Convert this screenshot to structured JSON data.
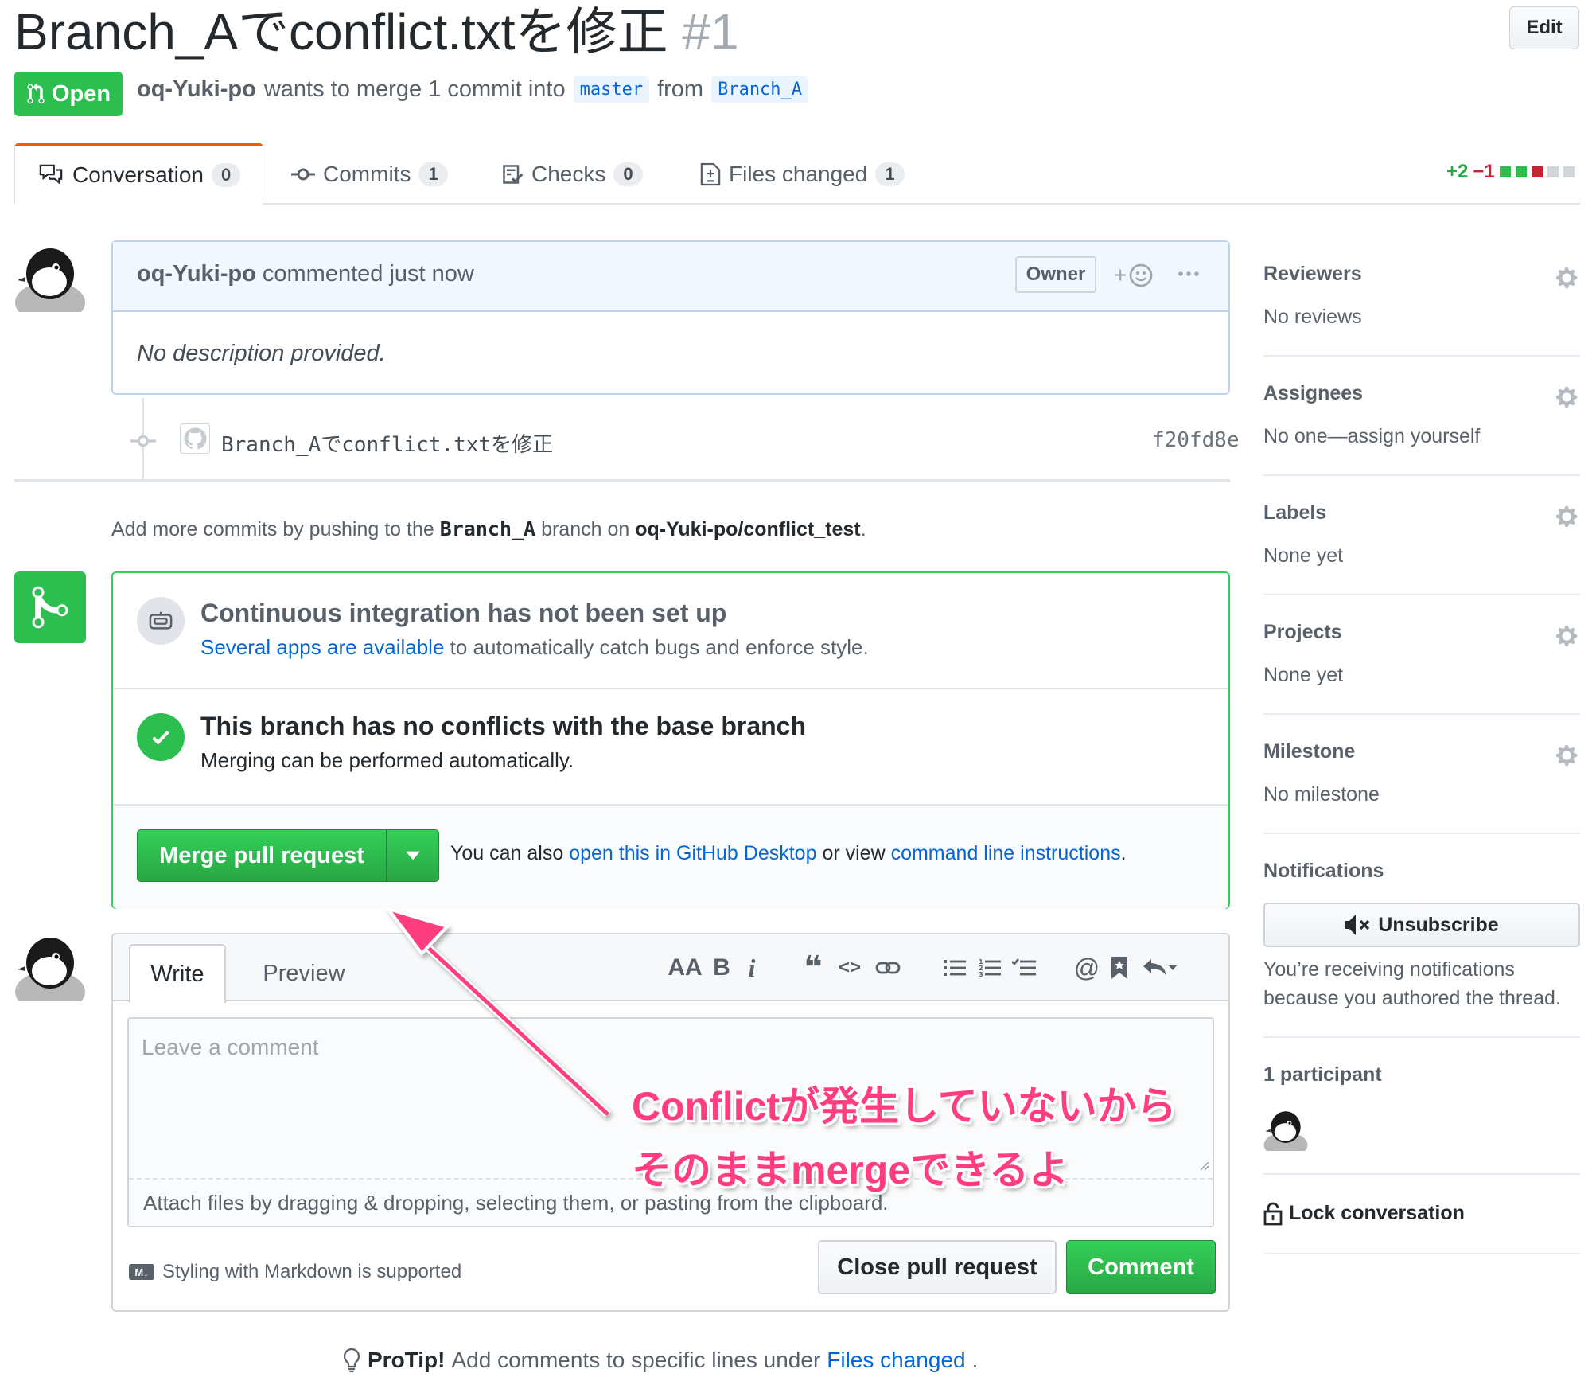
{
  "header": {
    "title": "Branch_Aでconflict.txtを修正",
    "number": "#1",
    "edit_label": "Edit",
    "state_label": "Open",
    "author": "oq-Yuki-po",
    "merge_text": "wants to merge 1 commit into",
    "base_branch": "master",
    "from_text": "from",
    "head_branch": "Branch_A"
  },
  "tabs": [
    {
      "label": "Conversation",
      "count": "0"
    },
    {
      "label": "Commits",
      "count": "1"
    },
    {
      "label": "Checks",
      "count": "0"
    },
    {
      "label": "Files changed",
      "count": "1"
    }
  ],
  "diffstat": {
    "additions": "+2",
    "deletions": "−1"
  },
  "comment": {
    "author": "oq-Yuki-po",
    "action": "commented just now",
    "role_badge": "Owner",
    "add_reaction": "+",
    "body": "No description provided."
  },
  "commit": {
    "message": "Branch_Aでconflict.txtを修正",
    "sha": "f20fd8e"
  },
  "push_note": {
    "prefix": "Add more commits by pushing to the",
    "branch": "Branch_A",
    "middle": "branch on",
    "repo": "oq-Yuki-po/conflict_test",
    "suffix": "."
  },
  "merge_box": {
    "ci_title": "Continuous integration has not been set up",
    "ci_link": "Several apps are available",
    "ci_rest": "to automatically catch bugs and enforce style.",
    "conflict_title": "This branch has no conflicts with the base branch",
    "conflict_sub": "Merging can be performed automatically.",
    "merge_button": "Merge pull request",
    "note_prefix": "You can also",
    "note_link1": "open this in GitHub Desktop",
    "note_mid": "or view",
    "note_link2": "command line instructions",
    "note_suffix": "."
  },
  "new_comment": {
    "tab_write": "Write",
    "tab_preview": "Preview",
    "placeholder": "Leave a comment",
    "attach_text": "Attach files by dragging & dropping, selecting them, or pasting from the clipboard.",
    "markdown_badge": "M↓",
    "markdown_note": "Styling with Markdown is supported",
    "close_button": "Close pull request",
    "comment_button": "Comment",
    "toolbar": {
      "heading": "AA",
      "bold": "B",
      "italic": "i",
      "quote": "❝",
      "code": "<>",
      "mention": "@"
    }
  },
  "protip": {
    "label": "ProTip!",
    "text": "Add comments to specific lines under",
    "link": "Files changed",
    "suffix": "."
  },
  "sidebar": {
    "reviewers": {
      "title": "Reviewers",
      "value": "No reviews"
    },
    "assignees": {
      "title": "Assignees",
      "value": "No one—assign yourself"
    },
    "labels": {
      "title": "Labels",
      "value": "None yet"
    },
    "projects": {
      "title": "Projects",
      "value": "None yet"
    },
    "milestone": {
      "title": "Milestone",
      "value": "No milestone"
    },
    "notifications": {
      "title": "Notifications",
      "button": "Unsubscribe",
      "line1": "You’re receiving notifications",
      "line2": "because you authored the thread."
    },
    "participants": {
      "title": "1 participant"
    },
    "lock": "Lock conversation"
  },
  "annotation": {
    "line1": "Conflictが発生していないから",
    "line2": "そのままmergeできるよ"
  },
  "colors": {
    "green": "#2cbe4e",
    "link": "#0366d6",
    "annotation": "#ff3d7f"
  }
}
